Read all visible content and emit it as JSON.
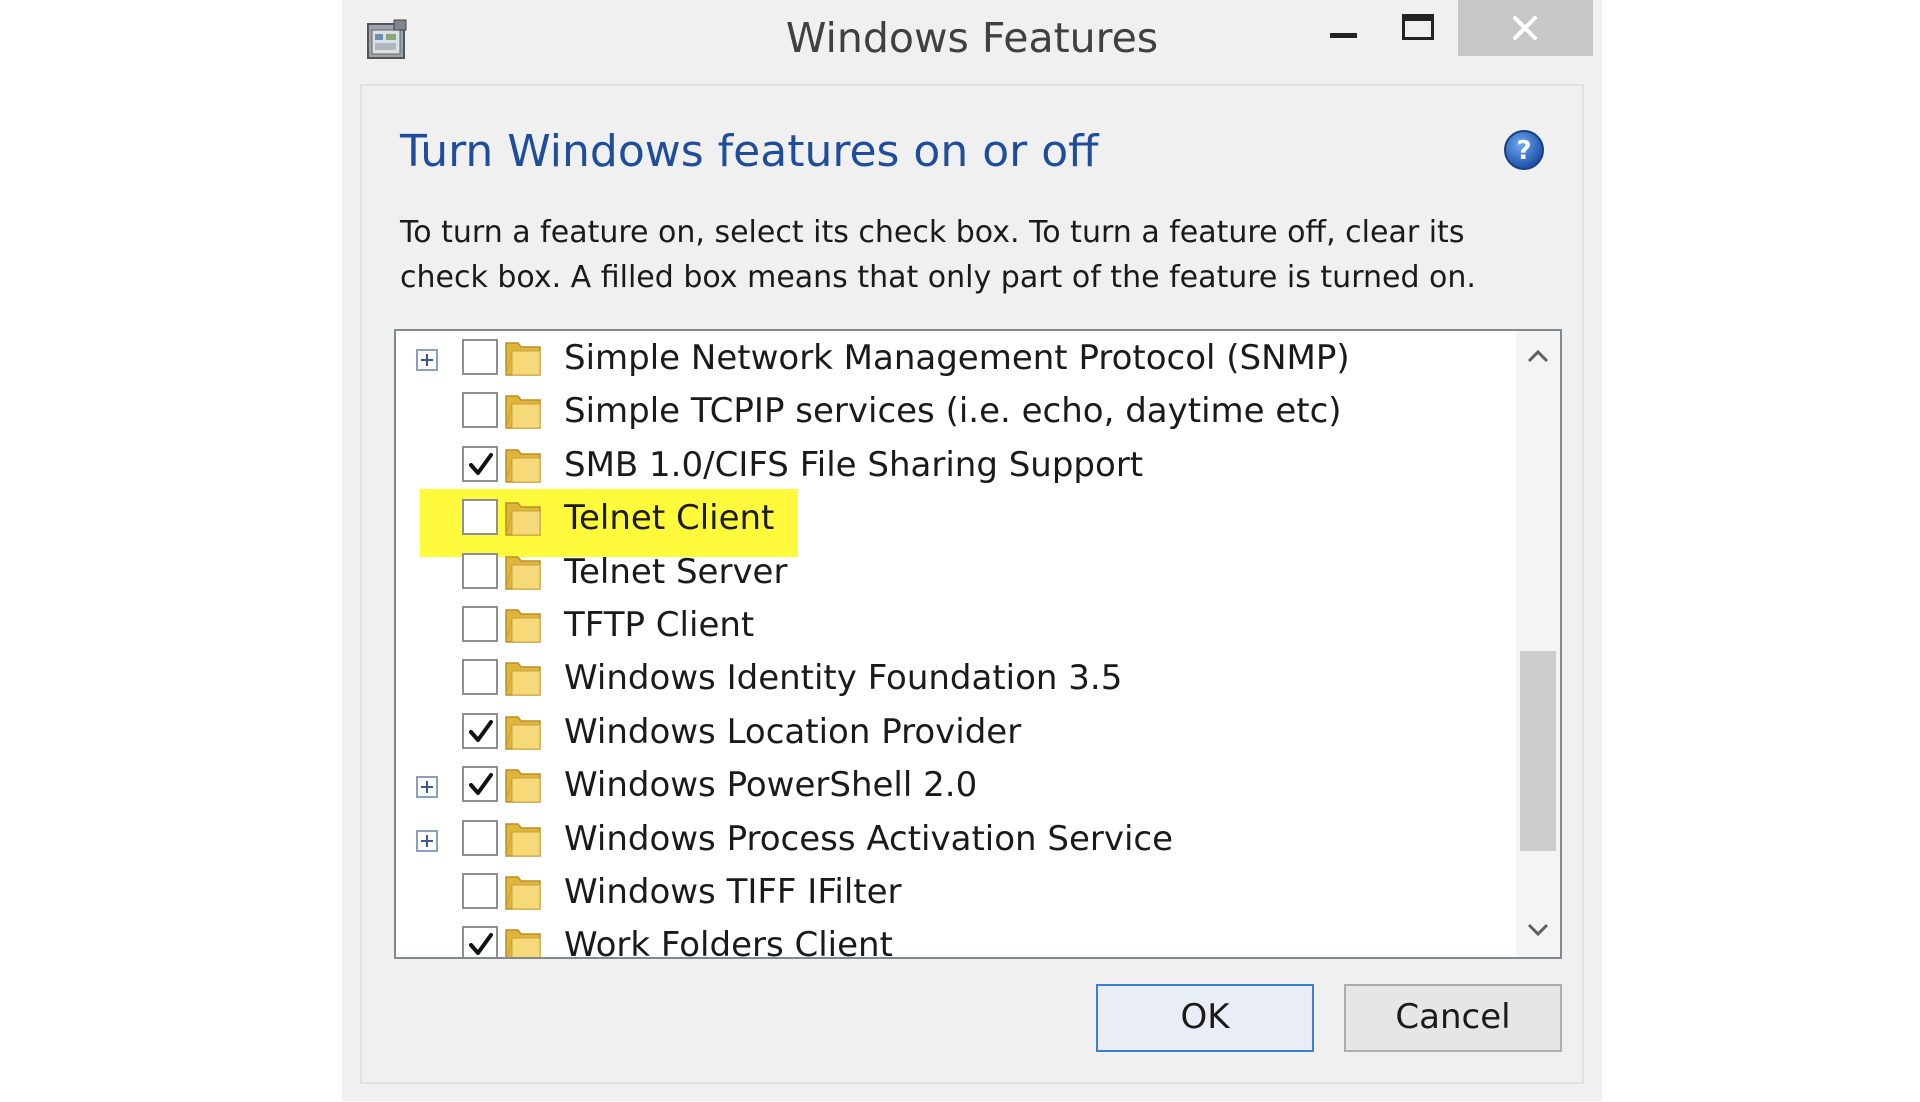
{
  "window": {
    "title": "Windows Features",
    "app_icon": "windows-features-app-icon",
    "controls": {
      "minimize": "minimize-icon",
      "maximize": "maximize-icon",
      "close": "close-icon"
    }
  },
  "header": {
    "heading": "Turn Windows features on or off",
    "help_icon": "help-icon",
    "description_line1": "To turn a feature on, select its check box. To turn a feature off, clear its",
    "description_line2": "check box. A filled box means that only part of the feature is turned on."
  },
  "features": [
    {
      "label": "Simple Network Management Protocol (SNMP)",
      "checked": false,
      "expandable": true
    },
    {
      "label": "Simple TCPIP services (i.e. echo, daytime etc)",
      "checked": false,
      "expandable": false
    },
    {
      "label": "SMB 1.0/CIFS File Sharing Support",
      "checked": true,
      "expandable": false
    },
    {
      "label": "Telnet Client",
      "checked": false,
      "expandable": false,
      "highlighted": true
    },
    {
      "label": "Telnet Server",
      "checked": false,
      "expandable": false
    },
    {
      "label": "TFTP Client",
      "checked": false,
      "expandable": false
    },
    {
      "label": "Windows Identity Foundation 3.5",
      "checked": false,
      "expandable": false
    },
    {
      "label": "Windows Location Provider",
      "checked": true,
      "expandable": false
    },
    {
      "label": "Windows PowerShell 2.0",
      "checked": true,
      "expandable": true
    },
    {
      "label": "Windows Process Activation Service",
      "checked": false,
      "expandable": true
    },
    {
      "label": "Windows TIFF IFilter",
      "checked": false,
      "expandable": false
    },
    {
      "label": "Work Folders Client",
      "checked": true,
      "expandable": false
    }
  ],
  "buttons": {
    "ok": "OK",
    "cancel": "Cancel"
  },
  "colors": {
    "highlight": "#fffb3c",
    "heading": "#1e4d9c",
    "folder": "#e8c14a"
  }
}
